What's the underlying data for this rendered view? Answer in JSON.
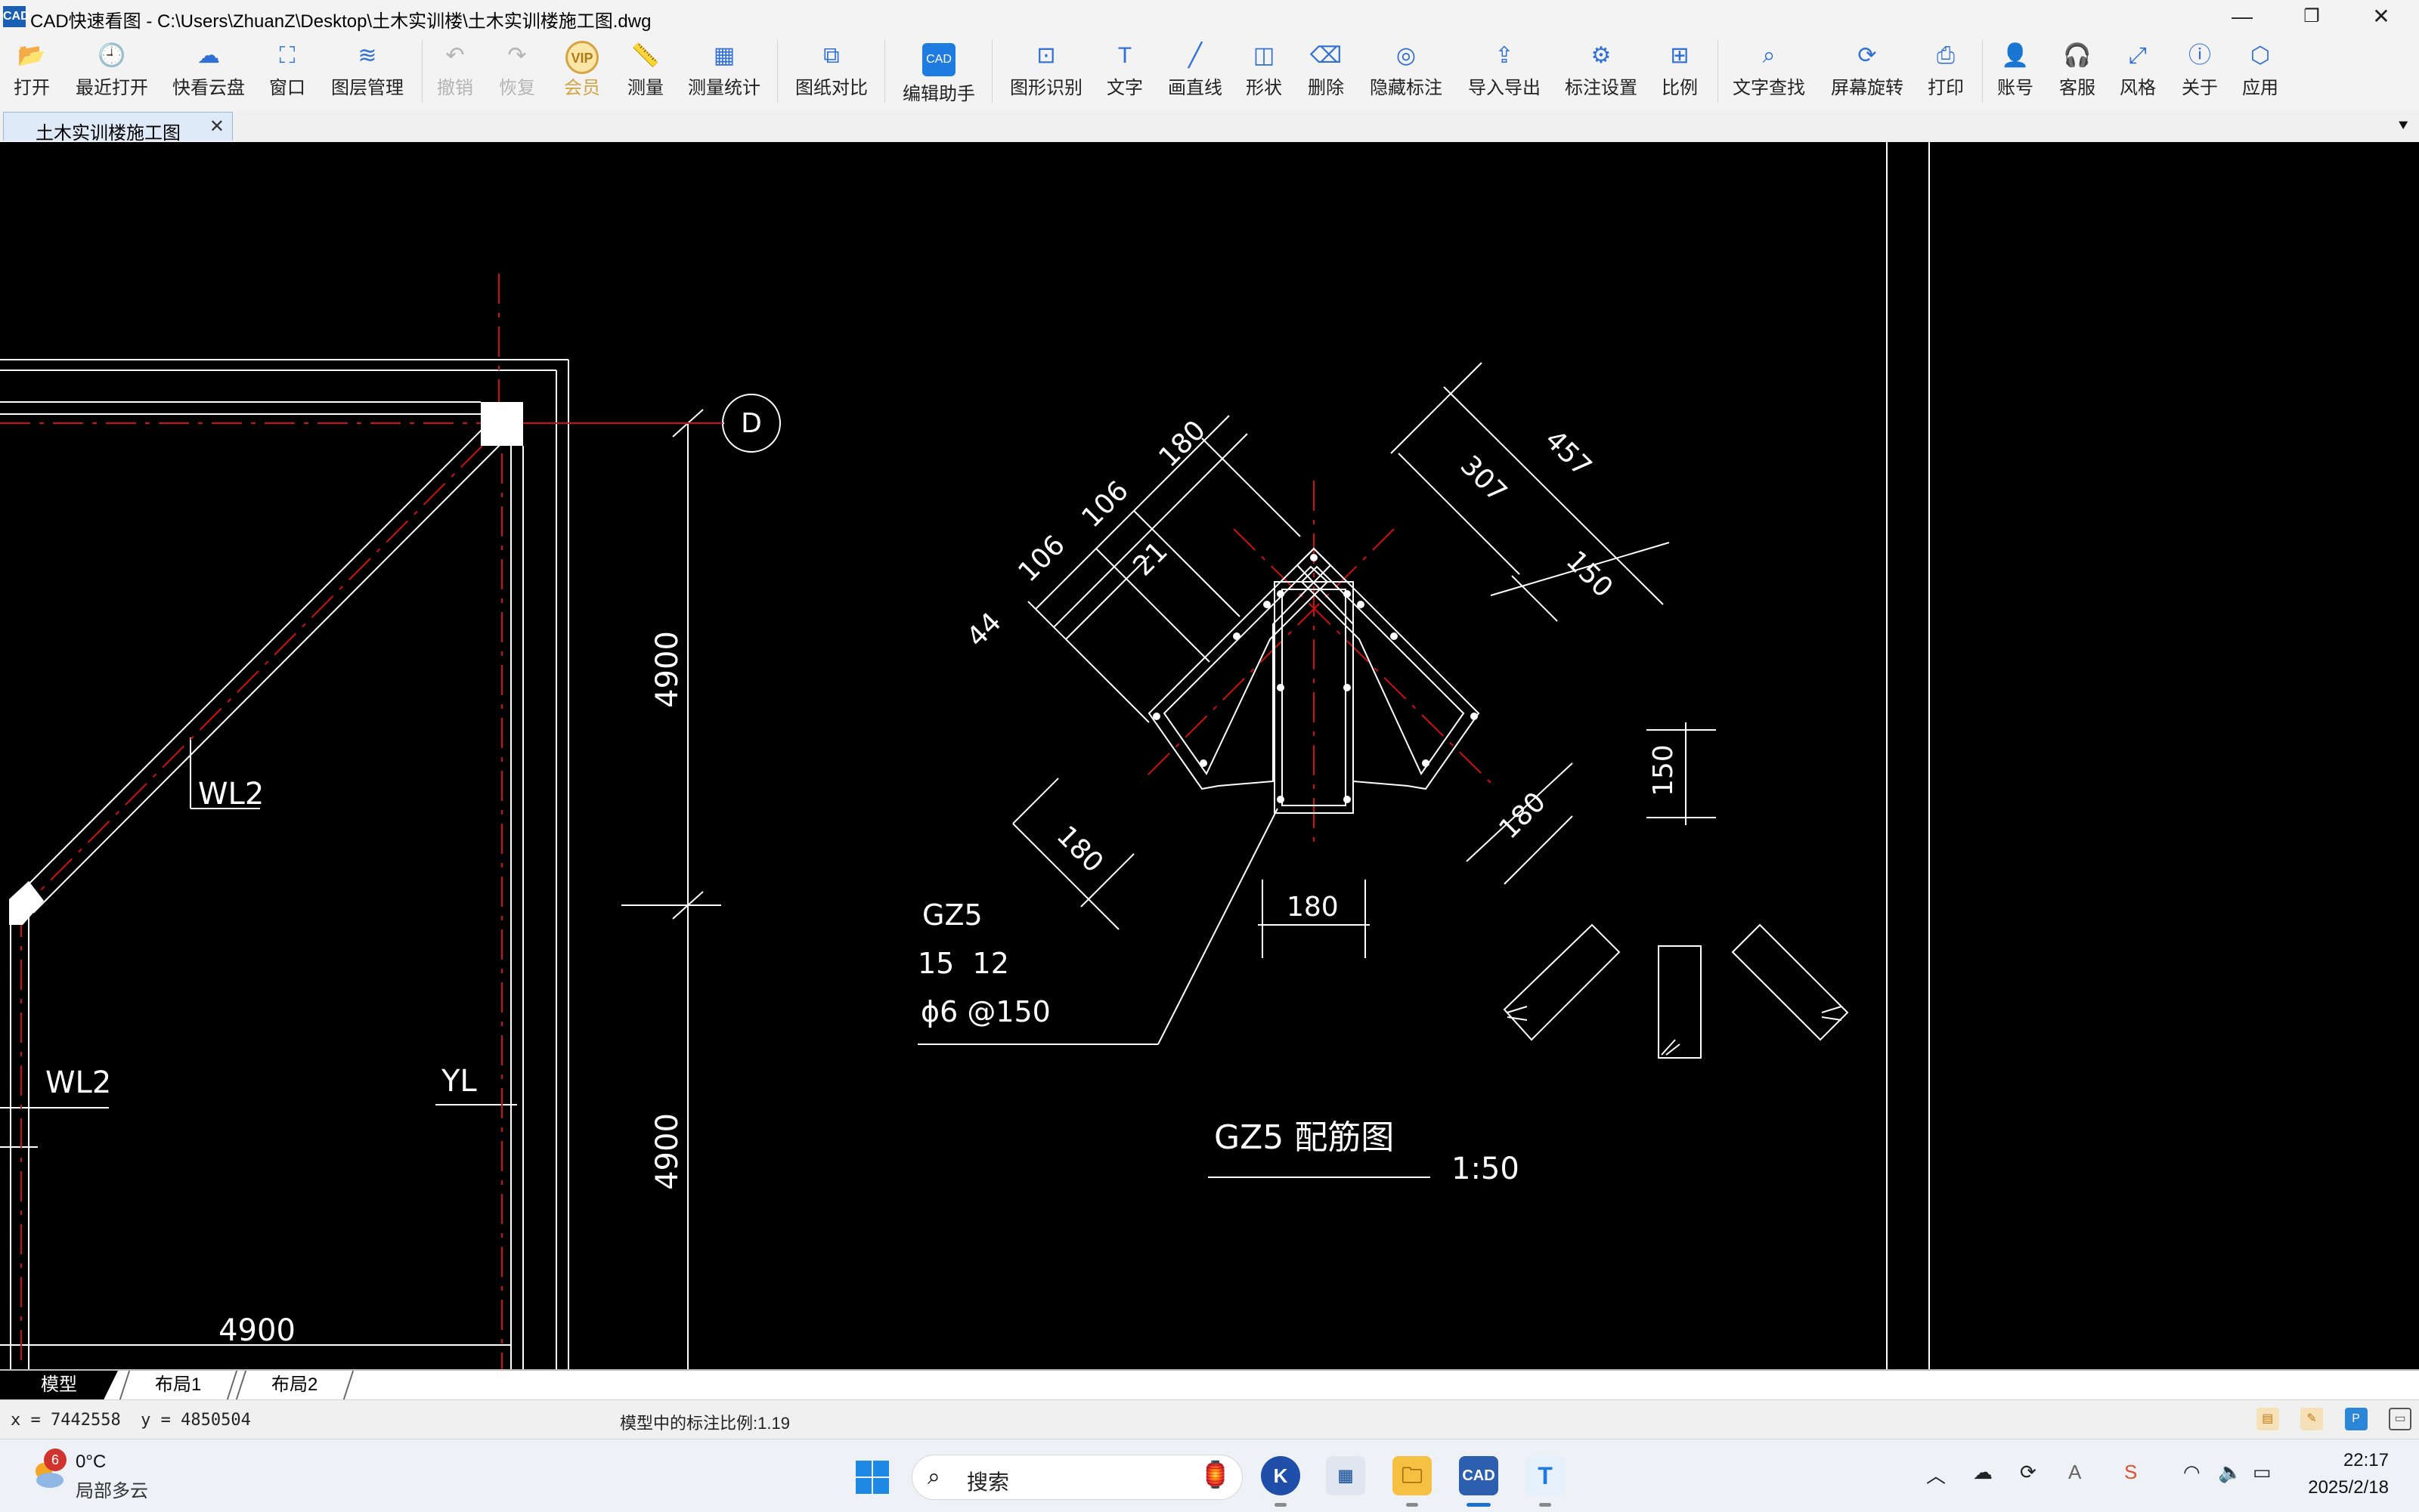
{
  "window": {
    "app_icon": "CAD",
    "title": "CAD快速看图 - C:\\Users\\ZhuanZ\\Desktop\\土木实训楼\\土木实训楼施工图.dwg",
    "minimize_glyph": "—",
    "restore_glyph": "❐",
    "close_glyph": "✕"
  },
  "toolbar": {
    "open": {
      "label": "打开",
      "icon": "folder-icon",
      "glyph": "📂"
    },
    "recent": {
      "label": "最近打开",
      "icon": "history-icon",
      "glyph": "🕘"
    },
    "cloud": {
      "label": "快看云盘",
      "icon": "cloud-icon",
      "glyph": "☁"
    },
    "window": {
      "label": "窗口",
      "icon": "window-icon",
      "glyph": "⛶"
    },
    "layers": {
      "label": "图层管理",
      "icon": "layers-icon",
      "glyph": "≋"
    },
    "undo": {
      "label": "撤销",
      "icon": "undo-icon",
      "glyph": "↶"
    },
    "redo": {
      "label": "恢复",
      "icon": "redo-icon",
      "glyph": "↷"
    },
    "vip": {
      "label": "会员",
      "badge": "VIP"
    },
    "measure": {
      "label": "测量",
      "icon": "ruler-icon",
      "glyph": "📏"
    },
    "measure_stats": {
      "label": "测量统计",
      "icon": "stats-icon",
      "glyph": "▦"
    },
    "compare": {
      "label": "图纸对比",
      "icon": "compare-icon",
      "glyph": "⧉"
    },
    "edit_assistant": {
      "label": "编辑助手",
      "badge": "CAD"
    },
    "recognize": {
      "label": "图形识别",
      "icon": "recognize-icon",
      "glyph": "⊡"
    },
    "text": {
      "label": "文字",
      "icon": "text-icon",
      "glyph": "T"
    },
    "line": {
      "label": "画直线",
      "icon": "line-icon",
      "glyph": "╱"
    },
    "shape": {
      "label": "形状",
      "icon": "shape-icon",
      "glyph": "◫"
    },
    "delete": {
      "label": "删除",
      "icon": "eraser-icon",
      "glyph": "⌫"
    },
    "hide_marks": {
      "label": "隐藏标注",
      "icon": "eye-off-icon",
      "glyph": "◎"
    },
    "import_export": {
      "label": "导入导出",
      "icon": "export-icon",
      "glyph": "⇪"
    },
    "mark_settings": {
      "label": "标注设置",
      "icon": "settings-icon",
      "glyph": "⚙"
    },
    "scale": {
      "label": "比例",
      "icon": "scale-icon",
      "glyph": "⊞"
    },
    "find_text": {
      "label": "文字查找",
      "icon": "find-icon",
      "glyph": "⌕"
    },
    "rotate": {
      "label": "屏幕旋转",
      "icon": "rotate-icon",
      "glyph": "⟳"
    },
    "print": {
      "label": "打印",
      "icon": "printer-icon",
      "glyph": "⎙"
    },
    "account": {
      "label": "账号",
      "icon": "user-icon",
      "glyph": "👤"
    },
    "support": {
      "label": "客服",
      "icon": "headset-icon",
      "glyph": "🎧"
    },
    "style": {
      "label": "风格",
      "icon": "style-icon",
      "glyph": "⤢"
    },
    "about": {
      "label": "关于",
      "icon": "info-icon",
      "glyph": "ⓘ"
    },
    "apps": {
      "label": "应用",
      "icon": "cube-icon",
      "glyph": "⬡"
    }
  },
  "tabs": {
    "document": "土木实训楼施工图",
    "close_glyph": "✕",
    "menu_glyph": "⯆"
  },
  "drawing": {
    "axis_label": "D",
    "dims": {
      "d4900_top": "4900",
      "d4900_bottom": "4900",
      "d4900_horizontal": "4900",
      "d180_a": "180",
      "d106_a": "106",
      "d106_b": "106",
      "d44": "44",
      "d21": "21",
      "d307": "307",
      "d457": "457",
      "d150_a": "150",
      "d180_b": "180",
      "d180_c": "180",
      "d180_d": "180",
      "d150_b": "150"
    },
    "labels": {
      "wl2_upper": "WL2",
      "wl2_lower": "WL2",
      "yl": "YL",
      "column_name": "GZ5",
      "rebar_spec": "15  12",
      "stirrup_spec": "ϕ6 @150",
      "detail_title": "GZ5 配筋图",
      "detail_scale": "1:50"
    }
  },
  "layout_tabs": [
    "模型",
    "布局1",
    "布局2"
  ],
  "status": {
    "coords": "x = 7442558  y = 4850504",
    "scale_note": "模型中的标注比例:1.19"
  },
  "taskbar": {
    "weather_badge": "6",
    "weather_temp": "0°C",
    "weather_desc": "局部多云",
    "search_placeholder": "搜索",
    "cad_app_label": "CAD",
    "k_app_label": "K",
    "t_app_label": "T",
    "time": "22:17",
    "date": "2025/2/18"
  }
}
